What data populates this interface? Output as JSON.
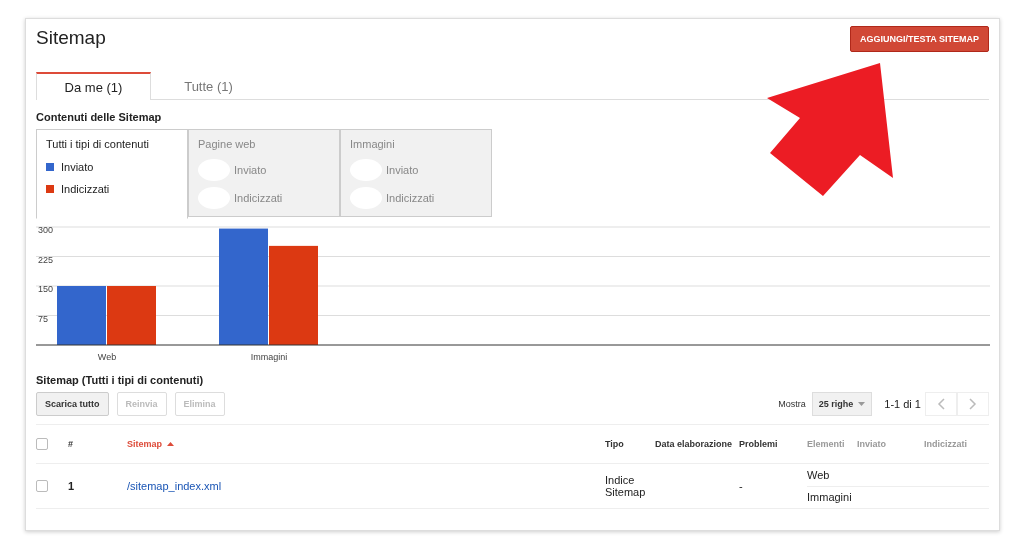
{
  "page": {
    "title": "Sitemap",
    "add_button": "AGGIUNGI/TESTA SITEMAP"
  },
  "tabs": [
    {
      "label": "Da me (1)",
      "selected": true
    },
    {
      "label": "Tutte (1)",
      "selected": false
    }
  ],
  "contents": {
    "heading": "Contenuti delle Sitemap",
    "panels": [
      {
        "title": "Tutti i tipi di contenuti",
        "selected": true,
        "kind": "series"
      },
      {
        "title": "Pagine web",
        "selected": false,
        "items": [
          {
            "label": "Inviato"
          },
          {
            "label": "Indicizzati"
          }
        ]
      },
      {
        "title": "Immagini",
        "selected": false,
        "items": [
          {
            "label": "Inviato"
          },
          {
            "label": "Indicizzati"
          }
        ]
      }
    ],
    "chart_data": {
      "type": "bar",
      "categories": [
        "Web",
        "Immagini"
      ],
      "series": [
        {
          "name": "Inviato",
          "color": "#3366cc",
          "values": [
            150,
            296
          ]
        },
        {
          "name": "Indicizzati",
          "color": "#dc3912",
          "values": [
            150,
            252
          ]
        }
      ],
      "ylim": [
        0,
        300
      ],
      "yticks": [
        75,
        150,
        225,
        300
      ],
      "grid": true
    }
  },
  "table_section": {
    "heading": "Sitemap (Tutti i tipi di contenuti)",
    "actions": [
      {
        "label": "Scarica tutto",
        "disabled": false
      },
      {
        "label": "Reinvia",
        "disabled": true
      },
      {
        "label": "Elimina",
        "disabled": true
      }
    ],
    "select_all_checked": false,
    "show_label": "Mostra",
    "rows_select": "25 righe",
    "range": "1-1 di 1",
    "columns": [
      {
        "label": "#",
        "sorted": false
      },
      {
        "label": "Sitemap",
        "sorted": true
      },
      {
        "label": "Tipo",
        "sorted": false
      },
      {
        "label": "Data elaborazione",
        "sorted": false
      },
      {
        "label": "Problemi",
        "sorted": false
      },
      {
        "label": "Elementi",
        "sorted": false,
        "muted": true
      },
      {
        "label": "Inviato",
        "sorted": false,
        "muted": true
      },
      {
        "label": "Indicizzati",
        "sorted": false,
        "muted": true
      }
    ],
    "rows": [
      {
        "checked": false,
        "number": "1",
        "sitemap": "/sitemap_index.xml",
        "type": "Indice Sitemap",
        "problems": "-",
        "elements": [
          "Web",
          "Immagini"
        ]
      }
    ]
  }
}
